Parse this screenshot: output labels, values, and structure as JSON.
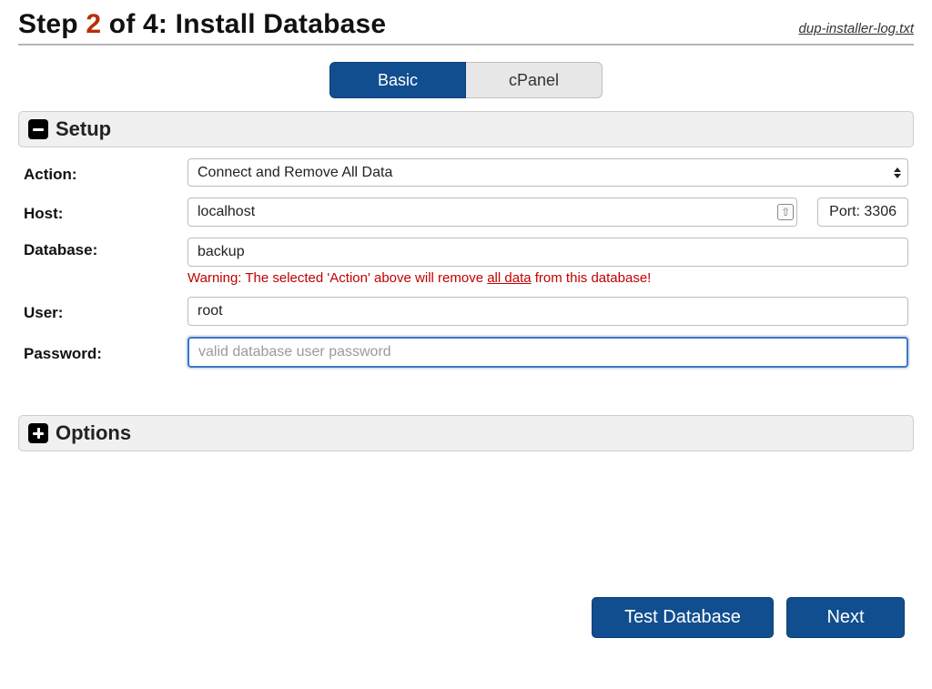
{
  "header": {
    "step_prefix": "Step",
    "step_num": "2",
    "step_of": "of 4:",
    "step_title": "Install Database",
    "log_link": "dup-installer-log.txt"
  },
  "tabs": {
    "basic": "Basic",
    "cpanel": "cPanel"
  },
  "sections": {
    "setup": "Setup",
    "options": "Options"
  },
  "labels": {
    "action": "Action:",
    "host": "Host:",
    "database": "Database:",
    "user": "User:",
    "password": "Password:"
  },
  "fields": {
    "action_selected": "Connect and Remove All Data",
    "host_value": "localhost",
    "port_label": "Port: 3306",
    "database_value": "backup",
    "user_value": "root",
    "password_value": "",
    "password_placeholder": "valid database user password"
  },
  "warning": {
    "pre": "Warning: The selected 'Action' above will remove ",
    "link": "all data",
    "post": " from this database!"
  },
  "buttons": {
    "test": "Test Database",
    "next": "Next"
  }
}
